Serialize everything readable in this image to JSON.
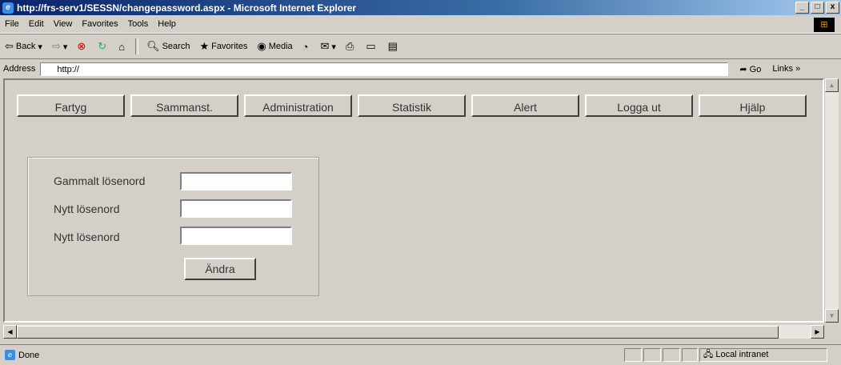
{
  "window": {
    "title": "http://frs-serv1/SESSN/changepassword.aspx - Microsoft Internet Explorer",
    "minimize": "_",
    "maximize": "□",
    "close": "x"
  },
  "menu": [
    "File",
    "Edit",
    "View",
    "Favorites",
    "Tools",
    "Help"
  ],
  "toolbar": {
    "back": "Back",
    "search": "Search",
    "favorites": "Favorites",
    "media": "Media"
  },
  "address": {
    "label": "Address",
    "value": "http://",
    "go": "Go",
    "links": "Links »"
  },
  "nav": [
    "Fartyg",
    "Sammanst.",
    "Administration",
    "Statistik",
    "Alert",
    "Logga ut",
    "Hjälp"
  ],
  "form": {
    "old_password_label": "Gammalt lösenord",
    "new_password_label": "Nytt lösenord",
    "confirm_password_label": "Nytt lösenord",
    "submit": "Ändra"
  },
  "status": {
    "text": "Done",
    "zone": "Local intranet"
  },
  "colors": {
    "face": "#d4d0c8",
    "title_start": "#0a246a",
    "title_end": "#a6caf0"
  }
}
